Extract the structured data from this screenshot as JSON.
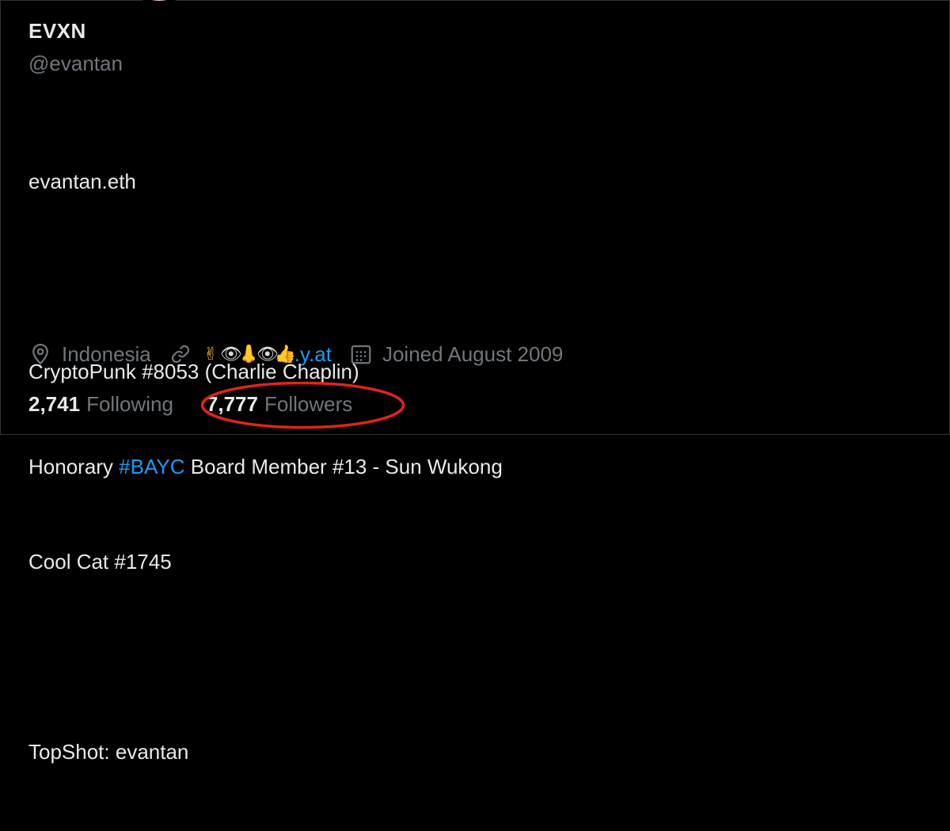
{
  "profile": {
    "display_name": "EVXN",
    "handle": "@evantan",
    "bio_lines": [
      "evantan.eth",
      "",
      "CryptoPunk #8053 (Charlie Chaplin)",
      "Honorary ",
      "Cool Cat #1745",
      "",
      "TopShot: evantan"
    ],
    "bio_hashtag": "#BAYC",
    "bio_hashtag_suffix": " Board Member #13 - Sun Wukong",
    "location": "Indonesia",
    "location_icon": "location-pin-icon",
    "link_emojis": [
      "✌",
      "👁",
      "👃",
      "👁",
      "👍"
    ],
    "link_suffix": ".y.at",
    "link_icon": "link-icon",
    "joined": "Joined August 2009",
    "joined_icon": "calendar-icon",
    "following_count": "2,741",
    "following_label": "Following",
    "followers_count": "7,777",
    "followers_label": "Followers"
  },
  "colors": {
    "background": "#000000",
    "text_primary": "#e7e9ea",
    "text_secondary": "#71767b",
    "link_blue": "#1d9bf0",
    "annotation_red": "#e0241b"
  }
}
